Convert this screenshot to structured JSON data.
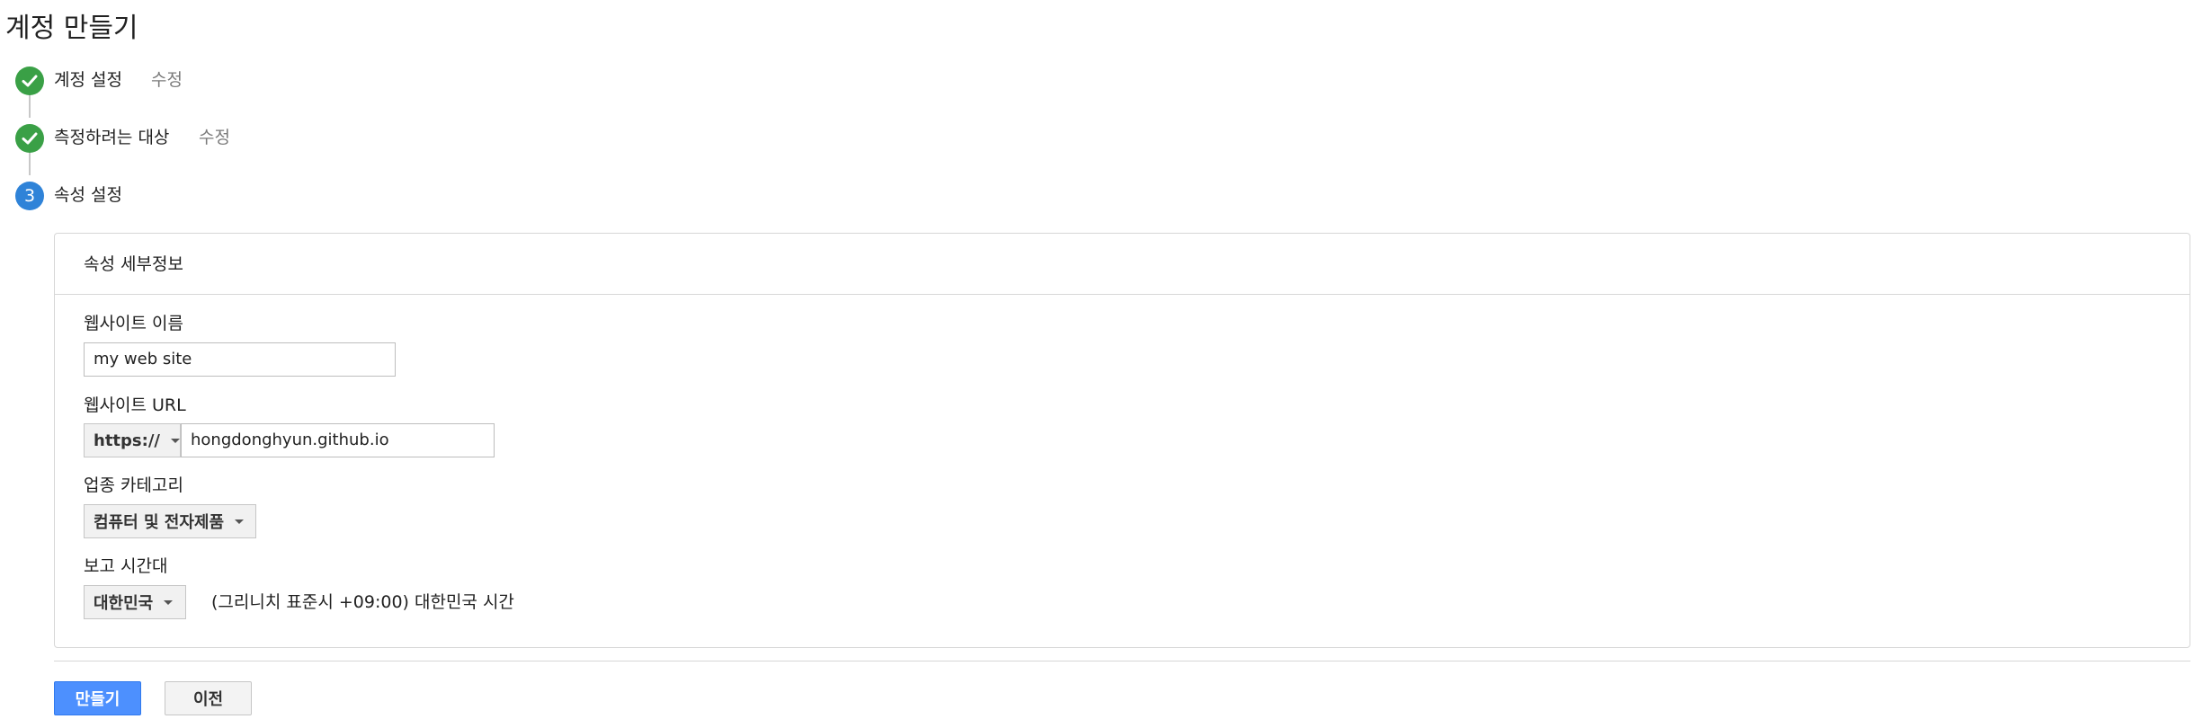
{
  "page": {
    "title": "계정 만들기"
  },
  "steps": [
    {
      "label": "계정 설정",
      "status": "done",
      "edit_label": "수정"
    },
    {
      "label": "측정하려는 대상",
      "status": "done",
      "edit_label": "수정"
    },
    {
      "label": "속성 설정",
      "status": "current",
      "number": "3"
    }
  ],
  "panel": {
    "title": "속성 세부정보",
    "website_name": {
      "label": "웹사이트 이름",
      "value": "my web site"
    },
    "website_url": {
      "label": "웹사이트 URL",
      "protocol": "https://",
      "value": "hongdonghyun.github.io"
    },
    "industry": {
      "label": "업종 카테고리",
      "selected": "컴퓨터 및 전자제품"
    },
    "timezone": {
      "label": "보고 시간대",
      "country": "대한민국",
      "zone_text": "(그리니치 표준시 +09:00) 대한민국 시간"
    }
  },
  "actions": {
    "create_label": "만들기",
    "previous_label": "이전"
  },
  "colors": {
    "step_done": "#3aa046",
    "step_current": "#2f83d8",
    "primary_button": "#4d90fe"
  },
  "icons": {
    "done_step": "checkmark-icon",
    "dropdown": "caret-down-icon"
  }
}
